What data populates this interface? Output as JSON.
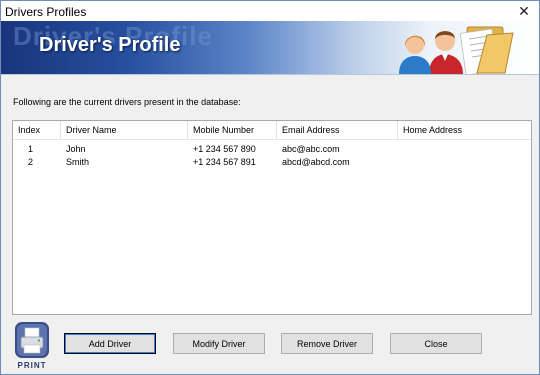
{
  "window": {
    "title": "Drivers Profiles",
    "close_glyph": "✕"
  },
  "banner": {
    "title": "Driver's Profile",
    "ghost_text": "Driver's Profile",
    "icon": "drivers-folder-icon"
  },
  "intro_text": "Following are the current drivers present in the database:",
  "table": {
    "columns": [
      "Index",
      "Driver Name",
      "Mobile Number",
      "Email Address",
      "Home Address"
    ],
    "rows": [
      [
        "1",
        "John",
        "+1 234 567 890",
        "abc@abc.com",
        ""
      ],
      [
        "2",
        "Smith",
        "+1 234 567 891",
        "abcd@abcd.com",
        ""
      ]
    ]
  },
  "print": {
    "label": "PRINT",
    "icon": "printer-icon"
  },
  "buttons": {
    "add": "Add Driver",
    "modify": "Modify Driver",
    "remove": "Remove Driver",
    "close": "Close"
  },
  "colors": {
    "banner_dark": "#19357c",
    "banner_light": "#ffffff",
    "default_button_focus": "#3c7fd6"
  }
}
